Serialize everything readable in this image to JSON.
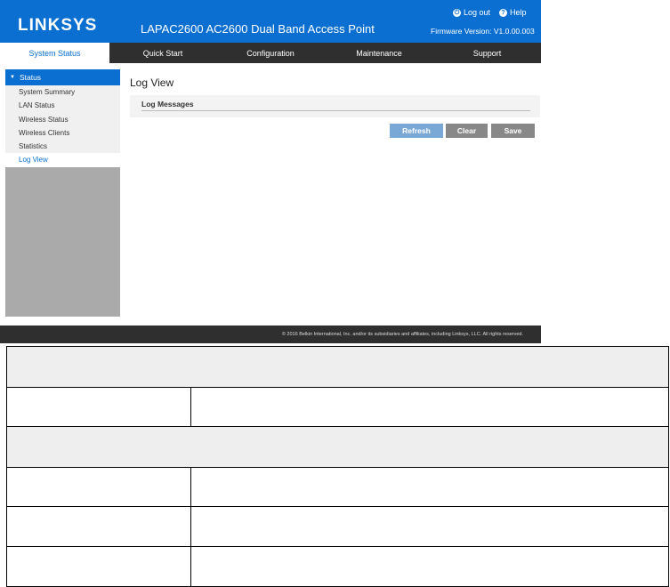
{
  "header": {
    "logo": "LINKSYS",
    "product": "LAPAC2600 AC2600 Dual Band Access Point",
    "logout_label": "Log out",
    "help_label": "Help",
    "firmware": "Firmware Version: V1.0.00.003"
  },
  "nav": {
    "tabs": [
      {
        "label": "System Status"
      },
      {
        "label": "Quick Start"
      },
      {
        "label": "Configuration"
      },
      {
        "label": "Maintenance"
      },
      {
        "label": "Support"
      }
    ],
    "active": "System Status"
  },
  "sidebar": {
    "group_label": "Status",
    "items": [
      {
        "label": "System Summary"
      },
      {
        "label": "LAN Status"
      },
      {
        "label": "Wireless Status"
      },
      {
        "label": "Wireless Clients"
      },
      {
        "label": "Statistics"
      },
      {
        "label": "Log View"
      }
    ],
    "active": "Log View"
  },
  "main": {
    "title": "Log View",
    "section_title": "Log Messages",
    "buttons": {
      "refresh": "Refresh",
      "clear": "Clear",
      "save": "Save"
    }
  },
  "footer": {
    "copyright": "© 2016 Belkin International, Inc. and/or its subsidiaries and affiliates, including Linksys, LLC. All rights reserved."
  },
  "colors": {
    "brand_blue": "#0a6fd1",
    "nav_dark": "#2f2f2f",
    "refresh_button": "#7aa8d6",
    "grey_button": "#888888"
  }
}
